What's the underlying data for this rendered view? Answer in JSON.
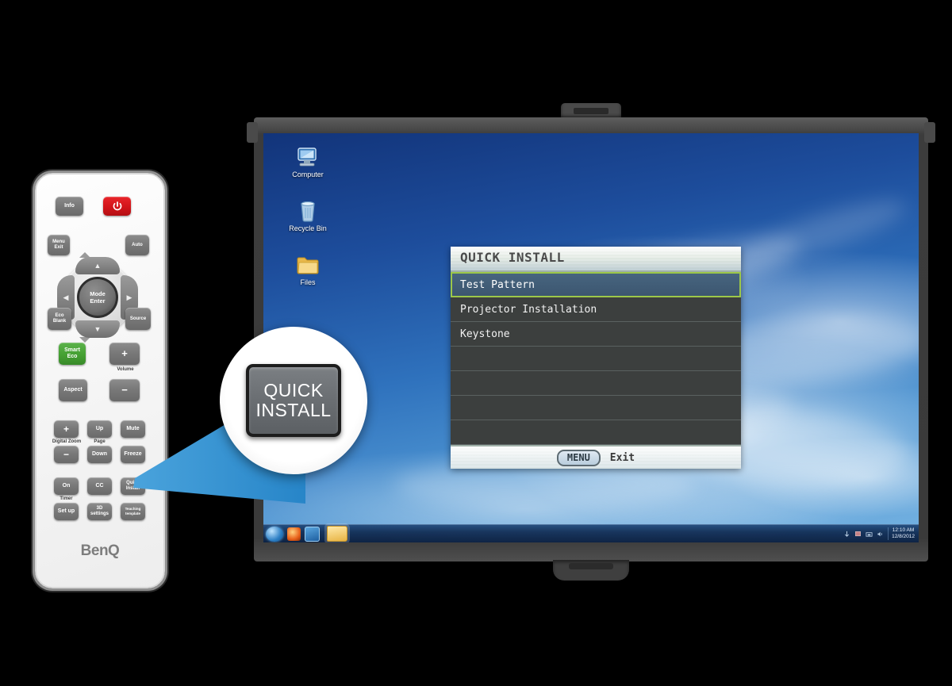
{
  "osd": {
    "title": "QUICK INSTALL",
    "rows": [
      {
        "label": "Test Pattern",
        "selected": true
      },
      {
        "label": "Projector Installation",
        "selected": false
      },
      {
        "label": "Keystone",
        "selected": false
      },
      {
        "label": "",
        "selected": false
      },
      {
        "label": "",
        "selected": false
      },
      {
        "label": "",
        "selected": false
      },
      {
        "label": "",
        "selected": false
      }
    ],
    "footer": {
      "menu_button": "MENU",
      "exit_label": "Exit"
    },
    "colors": {
      "highlight_border": "#9cc749",
      "highlight_fill": "#47657f",
      "body": "#3c3f3e"
    }
  },
  "desktop": {
    "icons": [
      {
        "label": "Computer",
        "icon": "computer-icon"
      },
      {
        "label": "Recycle Bin",
        "icon": "recycle-bin-icon"
      },
      {
        "label": "Files",
        "icon": "folder-icon"
      }
    ],
    "taskbar": {
      "start": "start-orb-icon",
      "quick_launch": [
        "browser-icon",
        "media-player-icon",
        "folder-icon"
      ],
      "tray": [
        "show-desktop-icon",
        "network-icon",
        "flag-icon",
        "volume-icon"
      ],
      "time": "12:10 AM",
      "date": "12/8/2012"
    }
  },
  "remote": {
    "brand": "BenQ",
    "buttons": [
      {
        "name": "info",
        "label": "Info"
      },
      {
        "name": "power",
        "label": "power-icon"
      },
      {
        "name": "menu-exit",
        "label": "Menu\nExit"
      },
      {
        "name": "auto",
        "label": "Auto"
      },
      {
        "name": "eco-blank",
        "label": "Eco\nBlank"
      },
      {
        "name": "source",
        "label": "Source"
      },
      {
        "name": "smart-eco",
        "label": "Smart\nEco"
      },
      {
        "name": "volume-up",
        "label": "+"
      },
      {
        "name": "volume-down",
        "label": "−"
      },
      {
        "name": "aspect",
        "label": "Aspect"
      },
      {
        "name": "digital-zoom-in",
        "label": "+"
      },
      {
        "name": "digital-zoom-out",
        "label": "−"
      },
      {
        "name": "page-up",
        "label": "Up"
      },
      {
        "name": "page-down",
        "label": "Down"
      },
      {
        "name": "mute",
        "label": "Mute"
      },
      {
        "name": "freeze",
        "label": "Freeze"
      },
      {
        "name": "timer-on",
        "label": "On"
      },
      {
        "name": "timer-setup",
        "label": "Set up"
      },
      {
        "name": "cc",
        "label": "CC"
      },
      {
        "name": "3d-settings",
        "label": "3D\nsettings"
      },
      {
        "name": "quick-install",
        "label": "Quick\nInstall"
      },
      {
        "name": "teaching-template",
        "label": "Teaching\ntemplate"
      }
    ],
    "captions": {
      "volume": "Volume",
      "digital_zoom": "Digital Zoom",
      "page": "Page",
      "timer": "Timer"
    },
    "dpad": {
      "center_line1": "Mode",
      "center_line2": "Enter",
      "up": "▲",
      "down": "▼",
      "left": "◀",
      "right": "▶"
    }
  },
  "callout": {
    "line1": "QUICK",
    "line2": "INSTALL",
    "accent_color": "#2f8fd0"
  }
}
